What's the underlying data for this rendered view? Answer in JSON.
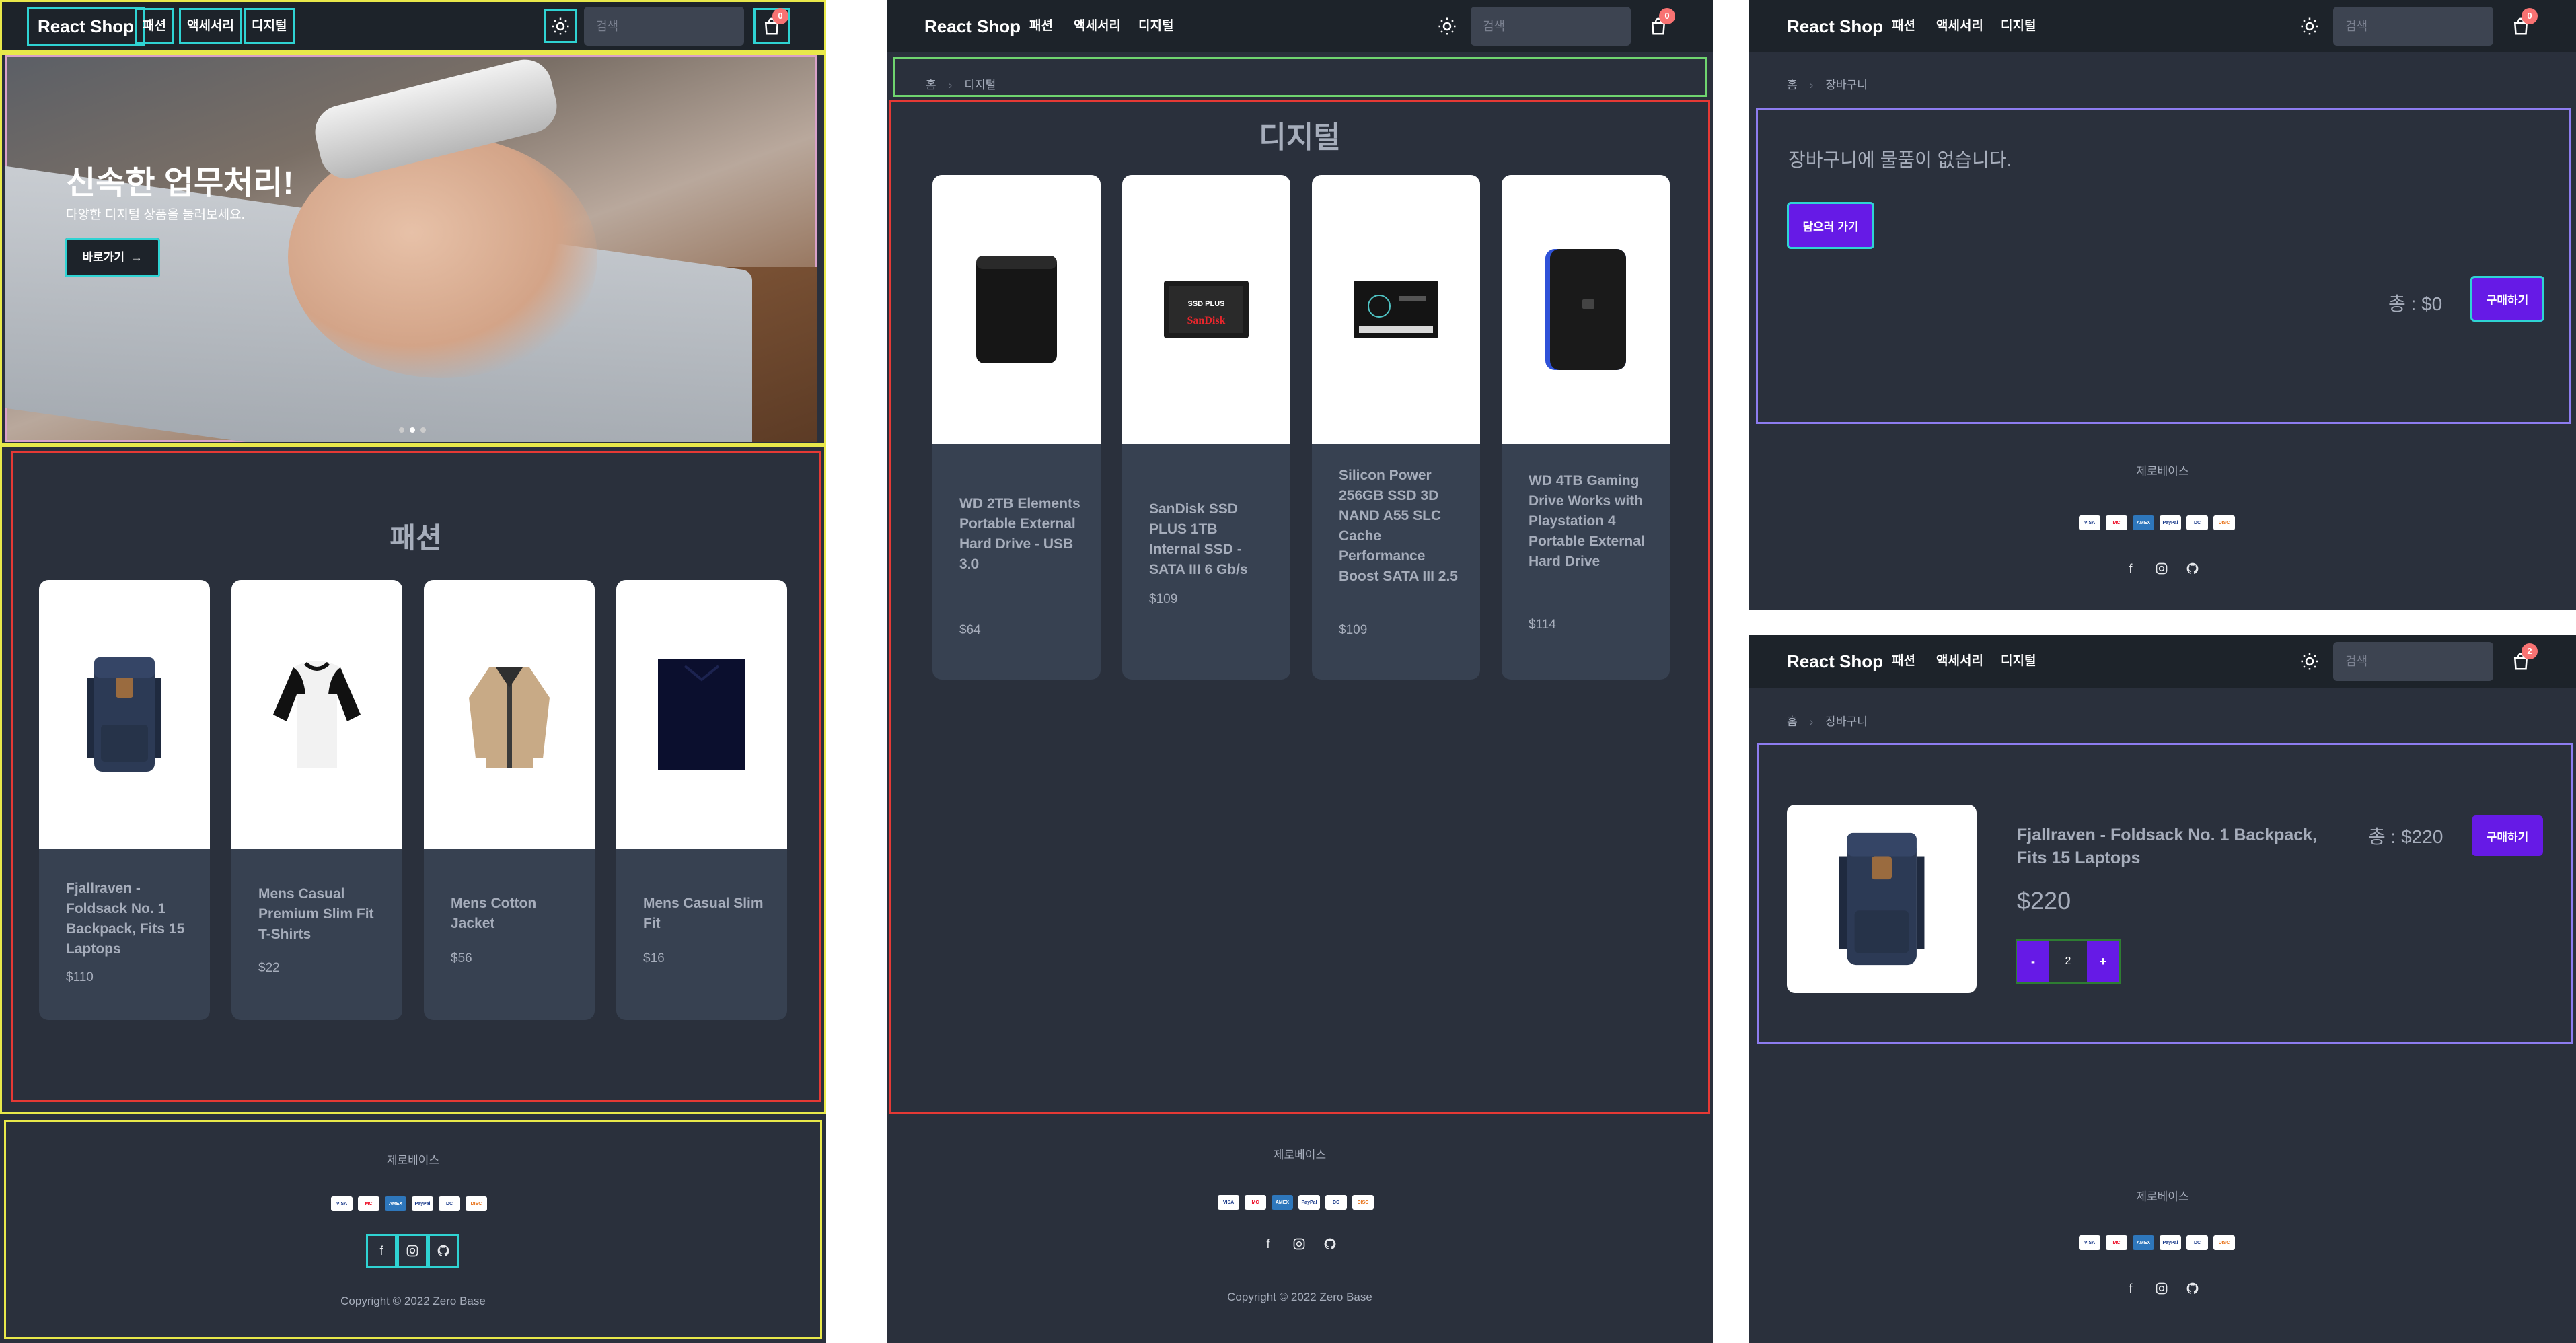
{
  "nav": {
    "brand": "React Shop",
    "links": [
      "패션",
      "액세서리",
      "디지털"
    ],
    "search_placeholder": "검색"
  },
  "panel_home": {
    "cart_count": "0",
    "hero": {
      "title": "신속한 업무처리!",
      "subtitle": "다양한 디지털 상품을 둘러보세요.",
      "button": "바로가기",
      "slide_count": 3,
      "active_slide": 1
    },
    "section_title": "패션",
    "products": [
      {
        "title": "Fjallraven - Foldsack No. 1 Backpack, Fits 15 Laptops",
        "price": "$110",
        "icon": "backpack-image"
      },
      {
        "title": "Mens Casual Premium Slim Fit T-Shirts",
        "price": "$22",
        "icon": "raglan-shirt-image"
      },
      {
        "title": "Mens Cotton Jacket",
        "price": "$56",
        "icon": "cotton-jacket-image"
      },
      {
        "title": "Mens Casual Slim Fit",
        "price": "$16",
        "icon": "navy-shirt-image"
      }
    ]
  },
  "panel_digital": {
    "cart_count": "0",
    "breadcrumb": [
      "홈",
      "디지털"
    ],
    "section_title": "디지털",
    "products": [
      {
        "title": "WD 2TB Elements Portable External Hard Drive - USB 3.0",
        "price": "$64",
        "icon": "hard-drive-image"
      },
      {
        "title": "SanDisk SSD PLUS 1TB Internal SSD - SATA III 6 Gb/s",
        "price": "$109",
        "icon": "sandisk-ssd-image",
        "label_line1": "SSD PLUS",
        "label_line2": "SanDisk"
      },
      {
        "title": "Silicon Power 256GB SSD 3D NAND A55 SLC Cache Performance Boost SATA III 2.5",
        "price": "$109",
        "icon": "silicon-ssd-image"
      },
      {
        "title": "WD 4TB Gaming Drive Works with Playstation 4 Portable External Hard Drive",
        "price": "$114",
        "icon": "gaming-drive-image"
      }
    ]
  },
  "panel_cart_empty": {
    "cart_count": "0",
    "breadcrumb": [
      "홈",
      "장바구니"
    ],
    "empty_message": "장바구니에 물품이 없습니다.",
    "shop_button": "담으러 가기",
    "total": "총 : $0",
    "buy_button": "구매하기"
  },
  "panel_cart_filled": {
    "cart_count": "2",
    "breadcrumb": [
      "홈",
      "장바구니"
    ],
    "item_title": "Fjallraven - Foldsack No. 1 Backpack, Fits 15 Laptops",
    "item_price": "$220",
    "minus": "-",
    "quantity": "2",
    "plus": "+",
    "total": "총 : $220",
    "buy_button": "구매하기"
  },
  "footer": {
    "company": "제로베이스",
    "payments": [
      "VISA",
      "MC",
      "AMEX",
      "PayPal",
      "DC",
      "DISC"
    ],
    "copyright": "Copyright © 2022 Zero Base"
  },
  "colors": {
    "page_bg": "#2a303c",
    "nav_bg": "#1d232a",
    "card_bg": "#374151",
    "primary": "#661ae6",
    "badge": "#f87272"
  }
}
